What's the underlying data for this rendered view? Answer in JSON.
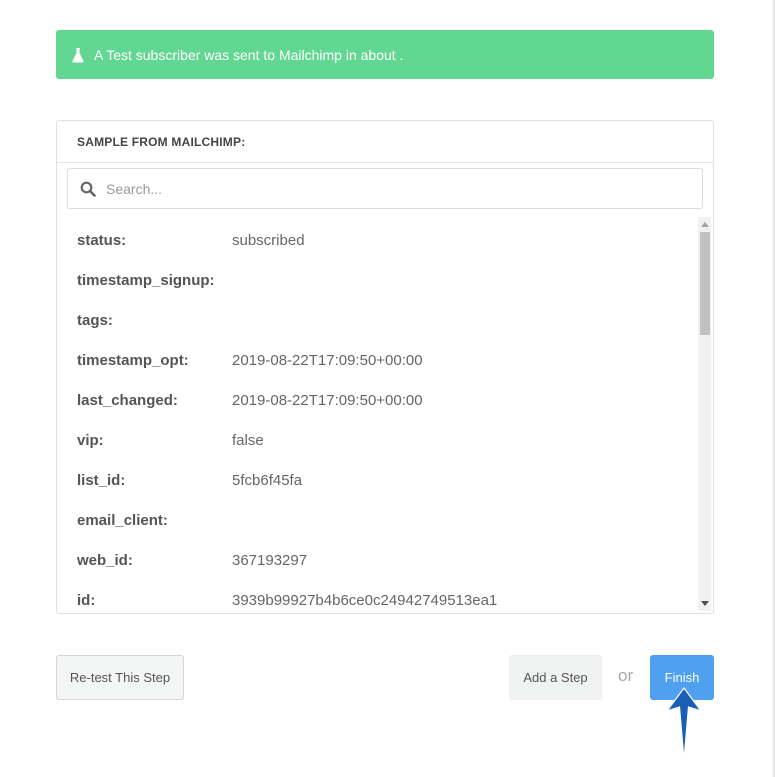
{
  "alert": {
    "icon": "flask-icon",
    "message": "A Test subscriber was sent to Mailchimp in about .",
    "color": "#61d792"
  },
  "sample_panel": {
    "title": "SAMPLE FROM MAILCHIMP:",
    "search_placeholder": "Search...",
    "fields": [
      {
        "key": "status:",
        "value": "subscribed"
      },
      {
        "key": "timestamp_signup:",
        "value": ""
      },
      {
        "key": "tags:",
        "value": ""
      },
      {
        "key": "timestamp_opt:",
        "value": "2019-08-22T17:09:50+00:00"
      },
      {
        "key": "last_changed:",
        "value": "2019-08-22T17:09:50+00:00"
      },
      {
        "key": "vip:",
        "value": "false"
      },
      {
        "key": "list_id:",
        "value": "5fcb6f45fa"
      },
      {
        "key": "email_client:",
        "value": ""
      },
      {
        "key": "web_id:",
        "value": "367193297"
      },
      {
        "key": "id:",
        "value": "3939b99927b4b6ce0c24942749513ea1"
      }
    ]
  },
  "actions": {
    "retest_label": "Re-test This Step",
    "add_step_label": "Add a Step",
    "or_label": "or",
    "finish_label": "Finish",
    "finish_color": "#4fa0ee"
  },
  "annotation": {
    "icon": "up-arrow-pointer-icon",
    "color": "#1a5fb4"
  }
}
